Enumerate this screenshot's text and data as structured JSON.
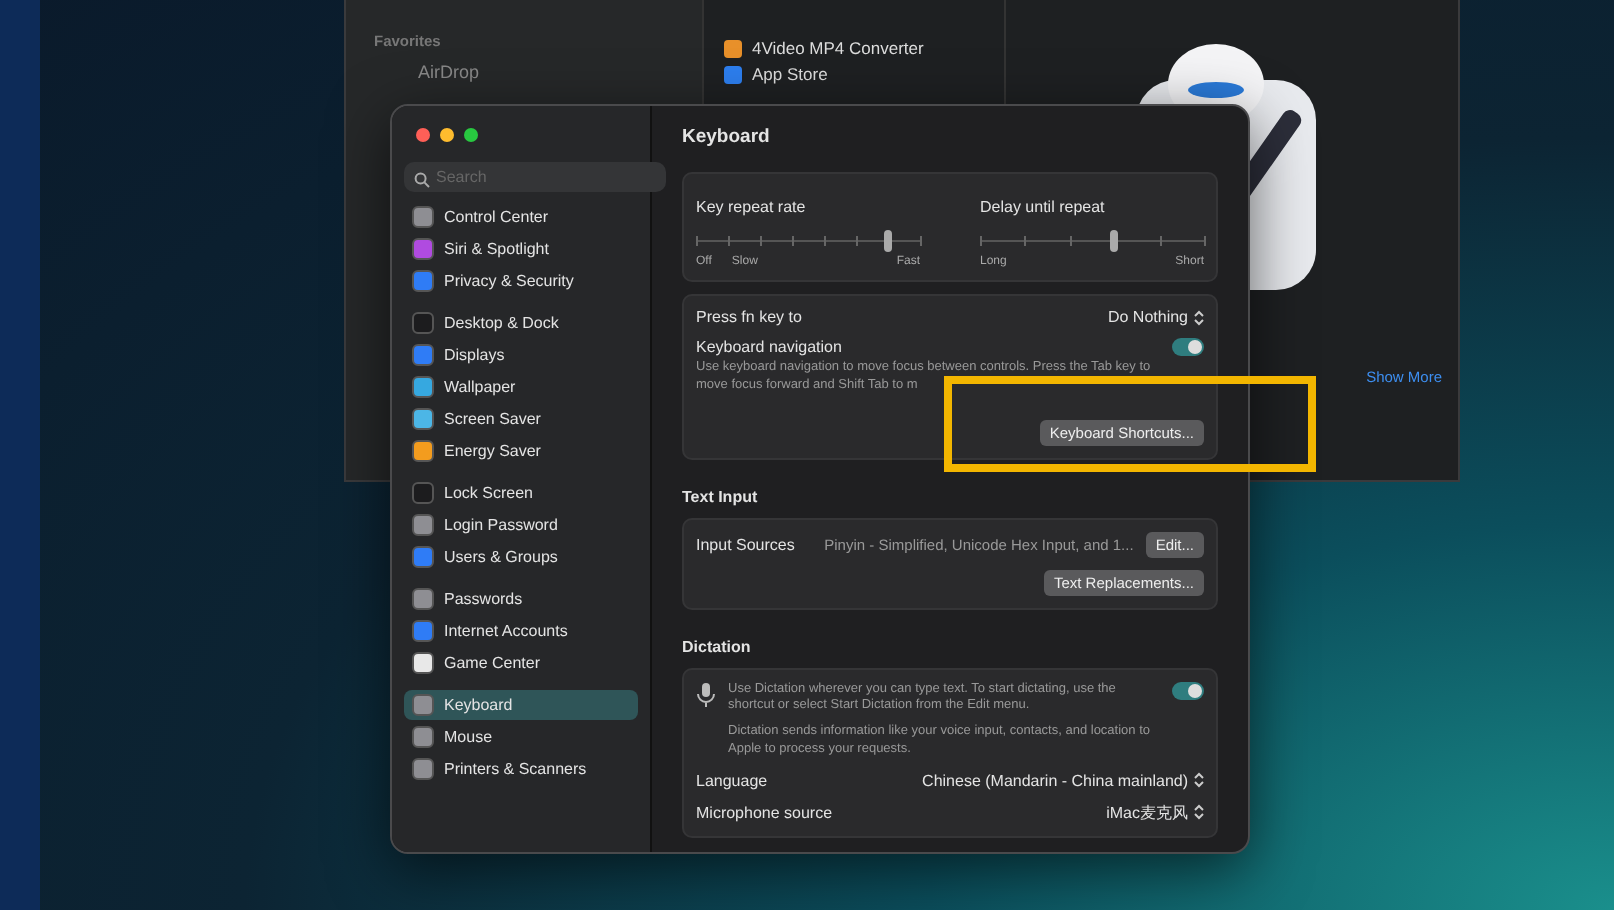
{
  "finder": {
    "sidebar_heading": "Favorites",
    "sidebar_items": [
      {
        "label": "AirDrop"
      }
    ],
    "files": [
      {
        "name": "4Video MP4 Converter",
        "color": "#e8902a",
        "selected": false
      },
      {
        "name": "App Store",
        "color": "#2d7ff0",
        "selected": false
      }
    ],
    "show_more": "Show More"
  },
  "settings": {
    "search": {
      "placeholder": "Search"
    },
    "sidebar": [
      [
        {
          "label": "Control Center",
          "color": "#8e8e93",
          "selected": false
        },
        {
          "label": "Siri & Spotlight",
          "color": "#b04be0",
          "selected": false
        },
        {
          "label": "Privacy & Security",
          "color": "#2f7cf6",
          "selected": false
        }
      ],
      [
        {
          "label": "Desktop & Dock",
          "color": "#1c1c1e",
          "selected": false
        },
        {
          "label": "Displays",
          "color": "#2f7cf6",
          "selected": false
        },
        {
          "label": "Wallpaper",
          "color": "#36a8e0",
          "selected": false
        },
        {
          "label": "Screen Saver",
          "color": "#4cb6e6",
          "selected": false
        },
        {
          "label": "Energy Saver",
          "color": "#f39c1e",
          "selected": false
        }
      ],
      [
        {
          "label": "Lock Screen",
          "color": "#1c1c1e",
          "selected": false
        },
        {
          "label": "Login Password",
          "color": "#8e8e93",
          "selected": false
        },
        {
          "label": "Users & Groups",
          "color": "#2f7cf6",
          "selected": false
        }
      ],
      [
        {
          "label": "Passwords",
          "color": "#8e8e93",
          "selected": false
        },
        {
          "label": "Internet Accounts",
          "color": "#2f7cf6",
          "selected": false
        },
        {
          "label": "Game Center",
          "color": "#e8e8e8",
          "selected": false
        }
      ],
      [
        {
          "label": "Keyboard",
          "color": "#8e8e93",
          "selected": true
        },
        {
          "label": "Mouse",
          "color": "#8e8e93",
          "selected": false
        },
        {
          "label": "Printers & Scanners",
          "color": "#8e8e93",
          "selected": false
        }
      ]
    ],
    "title": "Keyboard",
    "sliders": [
      {
        "label": "Key repeat rate",
        "level": 0.86,
        "marks": [
          "Off",
          "Slow",
          "Fast"
        ]
      },
      {
        "label": "Delay until repeat",
        "level": 0.6,
        "marks": [
          "Long",
          "Short"
        ]
      }
    ],
    "fn_key": {
      "label": "Press fn key to",
      "value": "Do Nothing"
    },
    "keyboard_navigation": {
      "label": "Keyboard navigation",
      "on": true,
      "description": "Use keyboard navigation to move focus between controls. Press the Tab key to move focus forward and Shift Tab to m"
    },
    "shortcuts_button": "Keyboard Shortcuts...",
    "text_input": {
      "heading": "Text Input",
      "label": "Input Sources",
      "value": "Pinyin - Simplified, Unicode Hex Input, and 1...",
      "edit_button": "Edit...",
      "replacements_button": "Text Replacements..."
    },
    "dictation": {
      "heading": "Dictation",
      "on": true,
      "description": "Use Dictation wherever you can type text. To start dictating, use the shortcut or select Start Dictation from the Edit menu.",
      "note": "Dictation sends information like your voice input, contacts, and location to Apple to process your requests.",
      "rows": [
        {
          "label": "Language",
          "value": "Chinese (Mandarin - China mainland)"
        },
        {
          "label": "Microphone source",
          "value": "iMac麦克风"
        }
      ]
    }
  }
}
